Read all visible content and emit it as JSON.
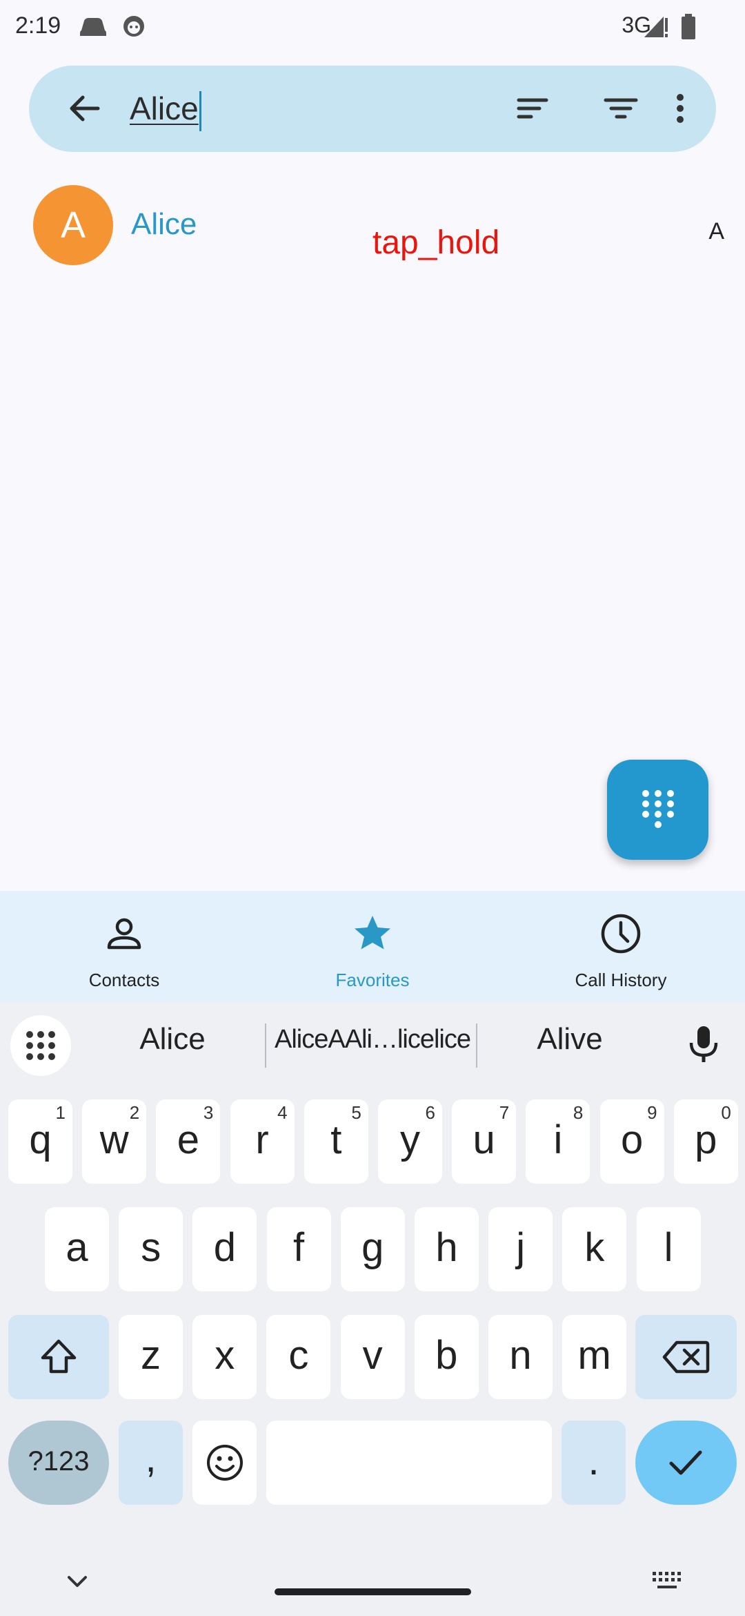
{
  "status_bar": {
    "time": "2:19",
    "network": "3G",
    "icons": [
      "car-icon",
      "android-debug-icon",
      "signal-icon",
      "battery-icon"
    ]
  },
  "search": {
    "value": "Alice",
    "icons": [
      "back-arrow-icon",
      "sort-icon",
      "filter-icon",
      "more-vert-icon"
    ]
  },
  "contacts": [
    {
      "initial": "A",
      "name": "Alice",
      "avatar_color": "#f59433"
    }
  ],
  "overlay_label": "tap_hold",
  "index_letter": "A",
  "fab": {
    "icon": "dialpad-icon",
    "color": "#2298cf"
  },
  "bottom_nav": [
    {
      "label": "Contacts",
      "icon": "person-icon",
      "active": false
    },
    {
      "label": "Favorites",
      "icon": "star-icon",
      "active": true
    },
    {
      "label": "Call History",
      "icon": "clock-icon",
      "active": false
    }
  ],
  "keyboard": {
    "suggestions": [
      "Alice",
      "AliceAAli…licelice",
      "Alive"
    ],
    "row1": [
      {
        "k": "q",
        "h": "1"
      },
      {
        "k": "w",
        "h": "2"
      },
      {
        "k": "e",
        "h": "3"
      },
      {
        "k": "r",
        "h": "4"
      },
      {
        "k": "t",
        "h": "5"
      },
      {
        "k": "y",
        "h": "6"
      },
      {
        "k": "u",
        "h": "7"
      },
      {
        "k": "i",
        "h": "8"
      },
      {
        "k": "o",
        "h": "9"
      },
      {
        "k": "p",
        "h": "0"
      }
    ],
    "row2": [
      "a",
      "s",
      "d",
      "f",
      "g",
      "h",
      "j",
      "k",
      "l"
    ],
    "row3": [
      "z",
      "x",
      "c",
      "v",
      "b",
      "n",
      "m"
    ],
    "symbols_label": "?123",
    "comma": ",",
    "period": "."
  },
  "colors": {
    "accent": "#2a98c7",
    "search_bg": "#c6e4f1",
    "nav_bg": "#e2f1fb",
    "overlay": "#e8160e"
  }
}
